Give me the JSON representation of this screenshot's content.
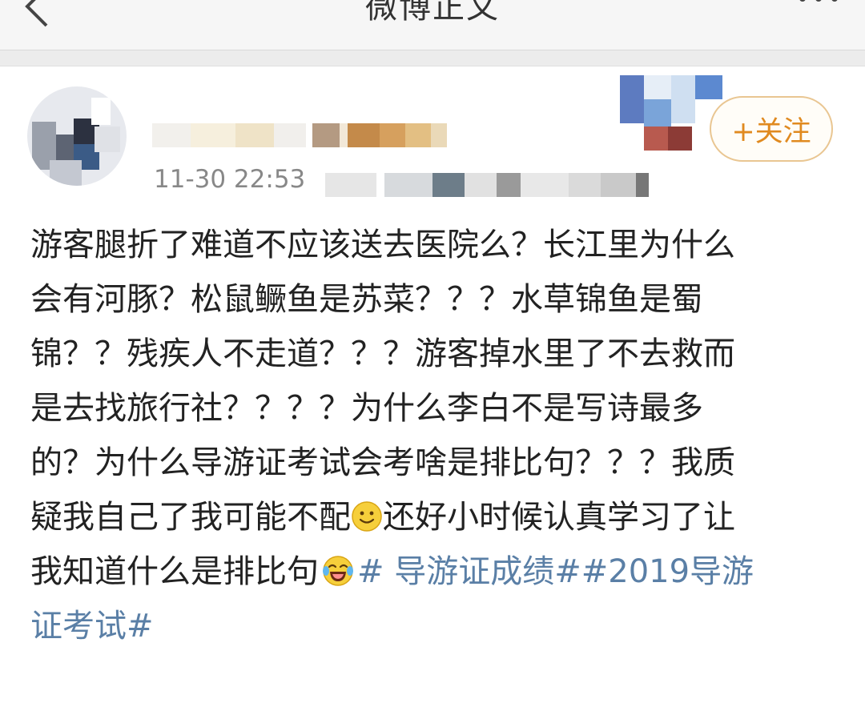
{
  "nav": {
    "title": "微博正文"
  },
  "post": {
    "timestamp": "11-30 22:53",
    "follow_label": "+关注",
    "content": {
      "line1": "游客腿折了难道不应该送去医院么？长江里为什么",
      "line2": "会有河豚？松鼠鳜鱼是苏菜？？？水草锦鱼是蜀",
      "line3": "锦？？残疾人不走道？？？游客掉水里了不去救而",
      "line4": "是去找旅行社？？？？为什么李白不是写诗最多",
      "line5": "的？为什么导游证考试会考啥是排比句？？？我质",
      "line6a": "疑我自己了我可能不配",
      "line6b": "还好小时候认真学习了让",
      "line7a": "我知道什么是排比句",
      "tag1": "# 导游证成绩#",
      "tag2a": "#2019导游",
      "tag2b": "证考试#"
    },
    "emojis": [
      "smile-emoji",
      "laugh-cry-emoji"
    ]
  },
  "colors": {
    "hashtag": "#5a7fa6",
    "follow_text": "#e08a20",
    "follow_border": "#e9c692"
  }
}
